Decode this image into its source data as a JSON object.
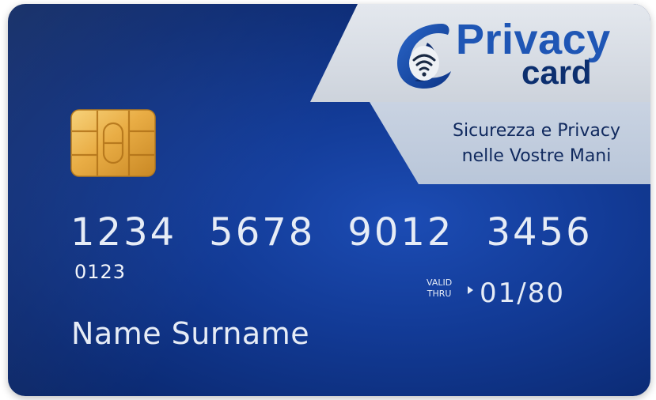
{
  "brand": {
    "line1": "Privacy",
    "line2": "card",
    "logo_icon": "wifi-shield-icon",
    "colors": {
      "primary": "#1f56b5",
      "dark": "#0c2f6f"
    }
  },
  "tagline": {
    "line1": "Sicurezza e Privacy",
    "line2": "nelle Vostre Mani"
  },
  "card": {
    "number_groups": [
      "1234",
      "5678",
      "9012",
      "3456"
    ],
    "short_number": "0123",
    "valid_label_line1": "VALID",
    "valid_label_line2": "THRU",
    "valid_date": "01/80",
    "holder_name": "Name Surname",
    "background_color": "#123a95",
    "chip_icon": "emv-chip-icon"
  }
}
